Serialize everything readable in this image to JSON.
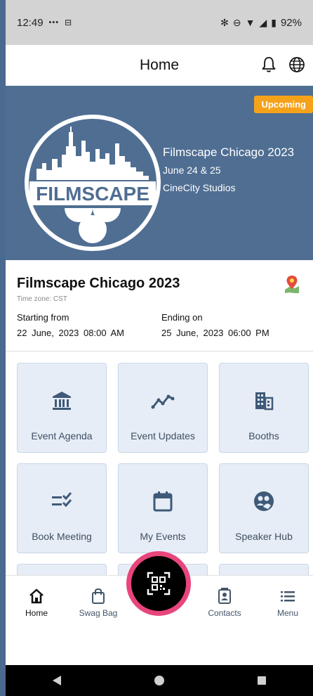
{
  "status_bar": {
    "time": "12:49",
    "dots": "•••",
    "battery": "92%"
  },
  "header": {
    "title": "Home",
    "icons": [
      "bell-icon",
      "globe-icon"
    ]
  },
  "banner": {
    "badge": "Upcoming",
    "logo_text": "FILMSCAPE",
    "title": "Filmscape Chicago 2023",
    "dates": "June 24 & 25",
    "venue": "CineCity Studios"
  },
  "event": {
    "name": "Filmscape Chicago 2023",
    "timezone": "Time zone: CST",
    "start_label": "Starting from",
    "start_value": "22 June, 2023  08:00 AM",
    "end_label": "Ending on",
    "end_value": "25 June, 2023  06:00 PM"
  },
  "tiles": [
    {
      "label": "Event Agenda",
      "icon": "bank-icon"
    },
    {
      "label": "Event Updates",
      "icon": "trend-icon"
    },
    {
      "label": "Booths",
      "icon": "building-icon"
    },
    {
      "label": "Book Meeting",
      "icon": "checklist-icon"
    },
    {
      "label": "My Events",
      "icon": "calendar-icon"
    },
    {
      "label": "Speaker Hub",
      "icon": "people-circle-icon"
    },
    {
      "label": "",
      "icon": "message-icon"
    },
    {
      "label": "",
      "icon": "pointer-icon"
    },
    {
      "label": "",
      "icon": "location-icon"
    }
  ],
  "nav": {
    "home": "Home",
    "swag": "Swag Bag",
    "contacts": "Contacts",
    "menu": "Menu"
  },
  "colors": {
    "banner": "#4f6e92",
    "badge": "#f5a21b",
    "tile_bg": "#e7edf6",
    "icon": "#3f5a78",
    "scan_ring": "#e8457b"
  }
}
